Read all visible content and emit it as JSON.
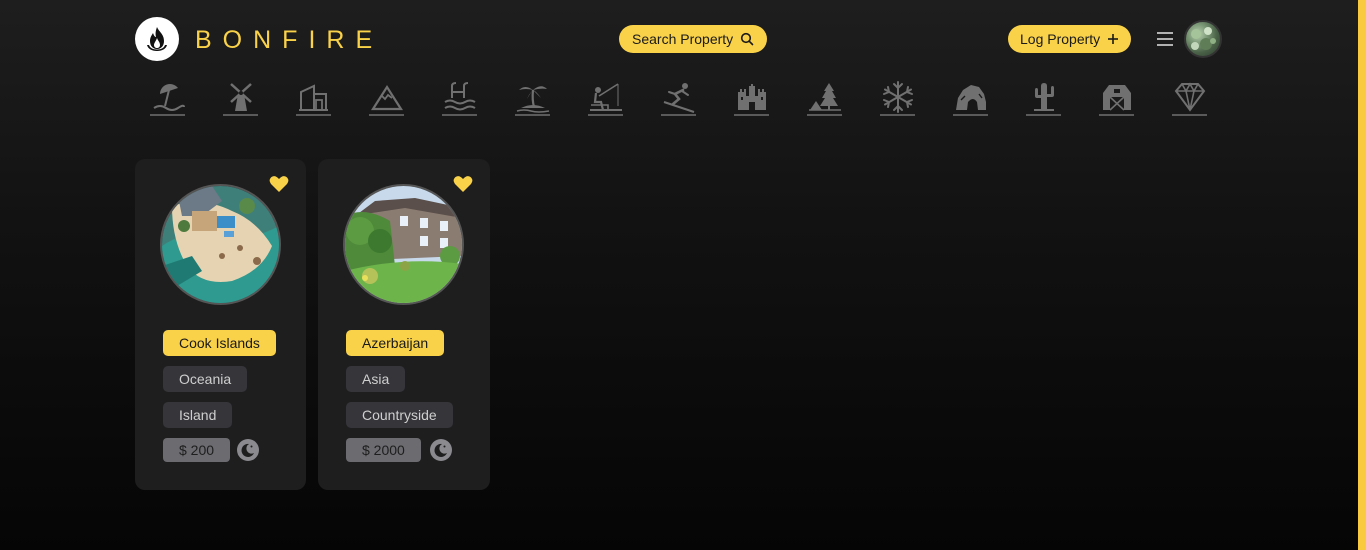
{
  "brand": {
    "name": "BONFIRE",
    "logo_icon": "flame-icon"
  },
  "header": {
    "search_label": "Search Property",
    "search_icon": "search-icon",
    "log_label": "Log Property",
    "log_icon": "plus-icon",
    "menu_icon": "hamburger-icon"
  },
  "categories": [
    "beach-umbrella",
    "windmill",
    "modern-house",
    "mountain",
    "pool",
    "tropical-island",
    "fishing",
    "skiing",
    "castle",
    "forest-camping",
    "snowflake",
    "cave",
    "desert-cactus",
    "barn",
    "diamond"
  ],
  "listings": [
    {
      "country": "Cook Islands",
      "region": "Oceania",
      "type": "Island",
      "price": "$ 200",
      "favorited": true
    },
    {
      "country": "Azerbaijan",
      "region": "Asia",
      "type": "Countryside",
      "price": "$ 2000",
      "favorited": true
    }
  ],
  "colors": {
    "accent": "#f9d24a",
    "card": "#1e1e1e",
    "tag": "#35353a"
  }
}
